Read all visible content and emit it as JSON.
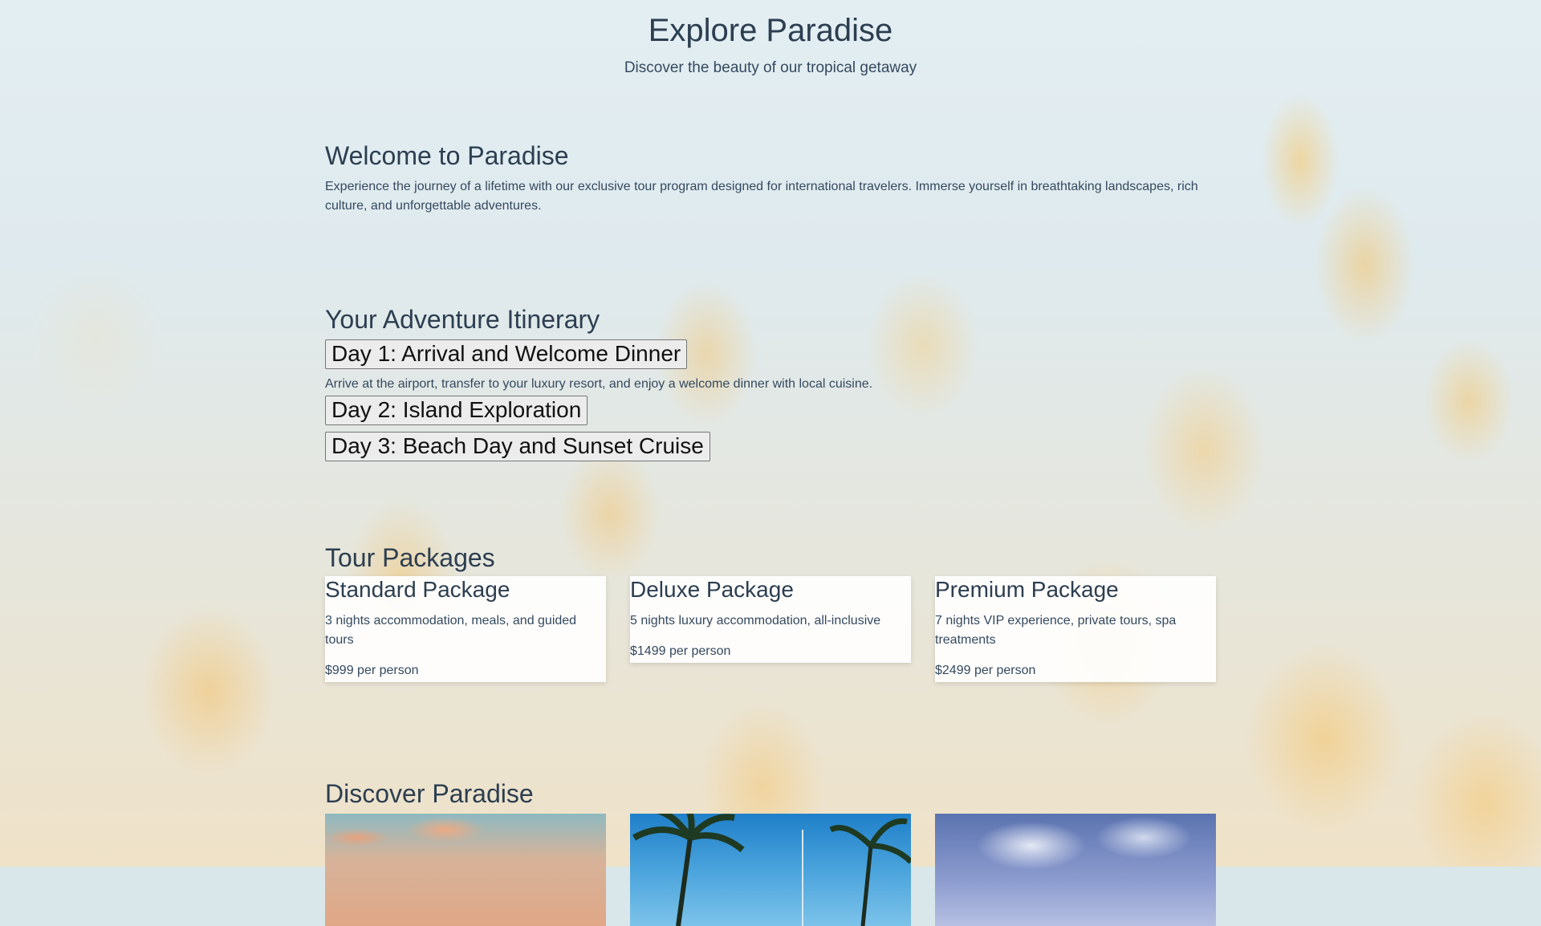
{
  "header": {
    "title": "Explore Paradise",
    "subtitle": "Discover the beauty of our tropical getaway"
  },
  "welcome": {
    "heading": "Welcome to Paradise",
    "text": "Experience the journey of a lifetime with our exclusive tour program designed for international travelers. Immerse yourself in breathtaking landscapes, rich culture, and unforgettable adventures."
  },
  "itinerary": {
    "heading": "Your Adventure Itinerary",
    "days": [
      {
        "label": "Day 1: Arrival and Welcome Dinner",
        "description": "Arrive at the airport, transfer to your luxury resort, and enjoy a welcome dinner with local cuisine.",
        "expanded": true
      },
      {
        "label": "Day 2: Island Exploration",
        "expanded": false
      },
      {
        "label": "Day 3: Beach Day and Sunset Cruise",
        "expanded": false
      }
    ]
  },
  "packages": {
    "heading": "Tour Packages",
    "items": [
      {
        "name": "Standard Package",
        "description": "3 nights accommodation, meals, and guided tours",
        "price": "$999 per person"
      },
      {
        "name": "Deluxe Package",
        "description": "5 nights luxury accommodation, all-inclusive",
        "price": "$1499 per person"
      },
      {
        "name": "Premium Package",
        "description": "7 nights VIP experience, private tours, spa treatments",
        "price": "$2499 per person"
      }
    ]
  },
  "discover": {
    "heading": "Discover Paradise"
  }
}
